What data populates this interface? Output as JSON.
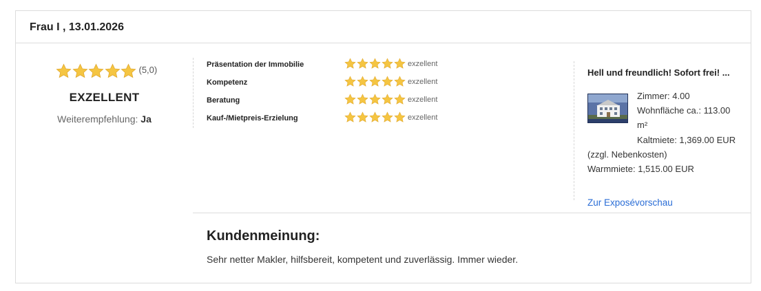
{
  "header": {
    "title": "Frau I , 13.01.2026"
  },
  "summary": {
    "stars": 5,
    "score_text": "(5,0)",
    "label": "EXZELLENT",
    "recommend_label": "Weiterempfehlung:",
    "recommend_value": "Ja"
  },
  "ratings": [
    {
      "label": "Präsentation der Immobilie",
      "stars": 5,
      "text": "exzellent"
    },
    {
      "label": "Kompetenz",
      "stars": 5,
      "text": "exzellent"
    },
    {
      "label": "Beratung",
      "stars": 5,
      "text": "exzellent"
    },
    {
      "label": "Kauf-/Mietpreis-Erzielung",
      "stars": 5,
      "text": "exzellent"
    }
  ],
  "property": {
    "title": "Hell und freundlich! Sofort frei! ...",
    "rooms": "Zimmer: 4.00",
    "area": "Wohnfläche ca.: 113.00 m²",
    "cold_rent": "Kaltmiete: 1,369.00 EUR (zzgl. Nebenkosten)",
    "warm_rent": "Warmmiete: 1,515.00 EUR",
    "link": "Zur Exposévorschau"
  },
  "review": {
    "heading": "Kundenmeinung:",
    "text": "Sehr netter Makler, hilfsbereit, kompetent und zuverlässig. Immer wieder."
  },
  "colors": {
    "star": "#f5c542",
    "star_stroke": "#e0a82e",
    "link": "#2a6dd6",
    "border": "#dcdcdc"
  }
}
